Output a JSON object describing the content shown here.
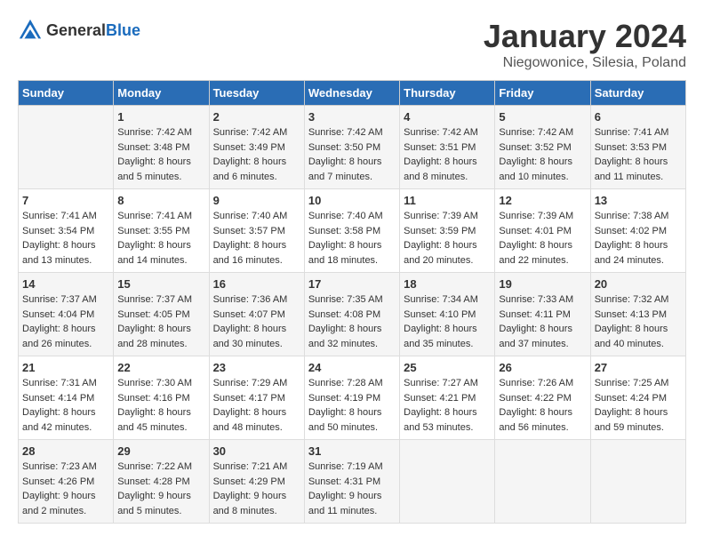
{
  "header": {
    "logo_general": "General",
    "logo_blue": "Blue",
    "month_title": "January 2024",
    "subtitle": "Niegowonice, Silesia, Poland"
  },
  "days_of_week": [
    "Sunday",
    "Monday",
    "Tuesday",
    "Wednesday",
    "Thursday",
    "Friday",
    "Saturday"
  ],
  "weeks": [
    [
      {
        "day": "",
        "sunrise": "",
        "sunset": "",
        "daylight": ""
      },
      {
        "day": "1",
        "sunrise": "Sunrise: 7:42 AM",
        "sunset": "Sunset: 3:48 PM",
        "daylight": "Daylight: 8 hours and 5 minutes."
      },
      {
        "day": "2",
        "sunrise": "Sunrise: 7:42 AM",
        "sunset": "Sunset: 3:49 PM",
        "daylight": "Daylight: 8 hours and 6 minutes."
      },
      {
        "day": "3",
        "sunrise": "Sunrise: 7:42 AM",
        "sunset": "Sunset: 3:50 PM",
        "daylight": "Daylight: 8 hours and 7 minutes."
      },
      {
        "day": "4",
        "sunrise": "Sunrise: 7:42 AM",
        "sunset": "Sunset: 3:51 PM",
        "daylight": "Daylight: 8 hours and 8 minutes."
      },
      {
        "day": "5",
        "sunrise": "Sunrise: 7:42 AM",
        "sunset": "Sunset: 3:52 PM",
        "daylight": "Daylight: 8 hours and 10 minutes."
      },
      {
        "day": "6",
        "sunrise": "Sunrise: 7:41 AM",
        "sunset": "Sunset: 3:53 PM",
        "daylight": "Daylight: 8 hours and 11 minutes."
      }
    ],
    [
      {
        "day": "7",
        "sunrise": "Sunrise: 7:41 AM",
        "sunset": "Sunset: 3:54 PM",
        "daylight": "Daylight: 8 hours and 13 minutes."
      },
      {
        "day": "8",
        "sunrise": "Sunrise: 7:41 AM",
        "sunset": "Sunset: 3:55 PM",
        "daylight": "Daylight: 8 hours and 14 minutes."
      },
      {
        "day": "9",
        "sunrise": "Sunrise: 7:40 AM",
        "sunset": "Sunset: 3:57 PM",
        "daylight": "Daylight: 8 hours and 16 minutes."
      },
      {
        "day": "10",
        "sunrise": "Sunrise: 7:40 AM",
        "sunset": "Sunset: 3:58 PM",
        "daylight": "Daylight: 8 hours and 18 minutes."
      },
      {
        "day": "11",
        "sunrise": "Sunrise: 7:39 AM",
        "sunset": "Sunset: 3:59 PM",
        "daylight": "Daylight: 8 hours and 20 minutes."
      },
      {
        "day": "12",
        "sunrise": "Sunrise: 7:39 AM",
        "sunset": "Sunset: 4:01 PM",
        "daylight": "Daylight: 8 hours and 22 minutes."
      },
      {
        "day": "13",
        "sunrise": "Sunrise: 7:38 AM",
        "sunset": "Sunset: 4:02 PM",
        "daylight": "Daylight: 8 hours and 24 minutes."
      }
    ],
    [
      {
        "day": "14",
        "sunrise": "Sunrise: 7:37 AM",
        "sunset": "Sunset: 4:04 PM",
        "daylight": "Daylight: 8 hours and 26 minutes."
      },
      {
        "day": "15",
        "sunrise": "Sunrise: 7:37 AM",
        "sunset": "Sunset: 4:05 PM",
        "daylight": "Daylight: 8 hours and 28 minutes."
      },
      {
        "day": "16",
        "sunrise": "Sunrise: 7:36 AM",
        "sunset": "Sunset: 4:07 PM",
        "daylight": "Daylight: 8 hours and 30 minutes."
      },
      {
        "day": "17",
        "sunrise": "Sunrise: 7:35 AM",
        "sunset": "Sunset: 4:08 PM",
        "daylight": "Daylight: 8 hours and 32 minutes."
      },
      {
        "day": "18",
        "sunrise": "Sunrise: 7:34 AM",
        "sunset": "Sunset: 4:10 PM",
        "daylight": "Daylight: 8 hours and 35 minutes."
      },
      {
        "day": "19",
        "sunrise": "Sunrise: 7:33 AM",
        "sunset": "Sunset: 4:11 PM",
        "daylight": "Daylight: 8 hours and 37 minutes."
      },
      {
        "day": "20",
        "sunrise": "Sunrise: 7:32 AM",
        "sunset": "Sunset: 4:13 PM",
        "daylight": "Daylight: 8 hours and 40 minutes."
      }
    ],
    [
      {
        "day": "21",
        "sunrise": "Sunrise: 7:31 AM",
        "sunset": "Sunset: 4:14 PM",
        "daylight": "Daylight: 8 hours and 42 minutes."
      },
      {
        "day": "22",
        "sunrise": "Sunrise: 7:30 AM",
        "sunset": "Sunset: 4:16 PM",
        "daylight": "Daylight: 8 hours and 45 minutes."
      },
      {
        "day": "23",
        "sunrise": "Sunrise: 7:29 AM",
        "sunset": "Sunset: 4:17 PM",
        "daylight": "Daylight: 8 hours and 48 minutes."
      },
      {
        "day": "24",
        "sunrise": "Sunrise: 7:28 AM",
        "sunset": "Sunset: 4:19 PM",
        "daylight": "Daylight: 8 hours and 50 minutes."
      },
      {
        "day": "25",
        "sunrise": "Sunrise: 7:27 AM",
        "sunset": "Sunset: 4:21 PM",
        "daylight": "Daylight: 8 hours and 53 minutes."
      },
      {
        "day": "26",
        "sunrise": "Sunrise: 7:26 AM",
        "sunset": "Sunset: 4:22 PM",
        "daylight": "Daylight: 8 hours and 56 minutes."
      },
      {
        "day": "27",
        "sunrise": "Sunrise: 7:25 AM",
        "sunset": "Sunset: 4:24 PM",
        "daylight": "Daylight: 8 hours and 59 minutes."
      }
    ],
    [
      {
        "day": "28",
        "sunrise": "Sunrise: 7:23 AM",
        "sunset": "Sunset: 4:26 PM",
        "daylight": "Daylight: 9 hours and 2 minutes."
      },
      {
        "day": "29",
        "sunrise": "Sunrise: 7:22 AM",
        "sunset": "Sunset: 4:28 PM",
        "daylight": "Daylight: 9 hours and 5 minutes."
      },
      {
        "day": "30",
        "sunrise": "Sunrise: 7:21 AM",
        "sunset": "Sunset: 4:29 PM",
        "daylight": "Daylight: 9 hours and 8 minutes."
      },
      {
        "day": "31",
        "sunrise": "Sunrise: 7:19 AM",
        "sunset": "Sunset: 4:31 PM",
        "daylight": "Daylight: 9 hours and 11 minutes."
      },
      {
        "day": "",
        "sunrise": "",
        "sunset": "",
        "daylight": ""
      },
      {
        "day": "",
        "sunrise": "",
        "sunset": "",
        "daylight": ""
      },
      {
        "day": "",
        "sunrise": "",
        "sunset": "",
        "daylight": ""
      }
    ]
  ]
}
